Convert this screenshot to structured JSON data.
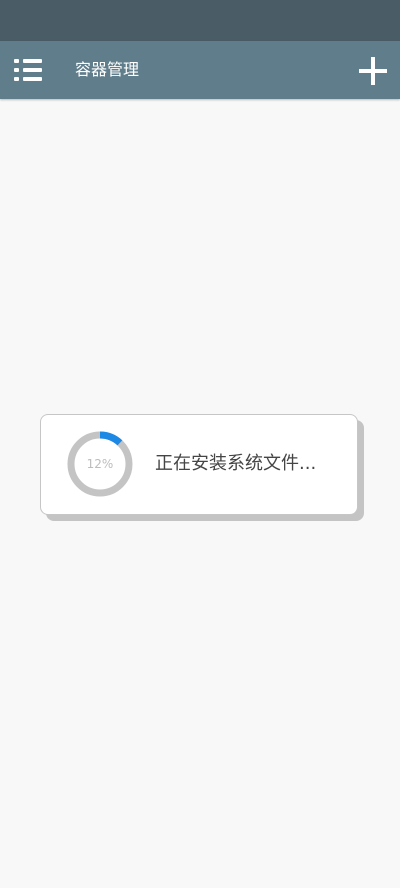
{
  "app_bar": {
    "title": "容器管理",
    "menu_icon": "list-menu-icon",
    "add_icon": "plus-icon",
    "color": "#607d8b",
    "status_bar_color": "#4a5d67"
  },
  "progress_dialog": {
    "progress_percent": 12,
    "progress_label": "12%",
    "message": "正在安装系统文件...",
    "track_color": "#c4c4c4",
    "fill_color": "#1e88e5"
  }
}
